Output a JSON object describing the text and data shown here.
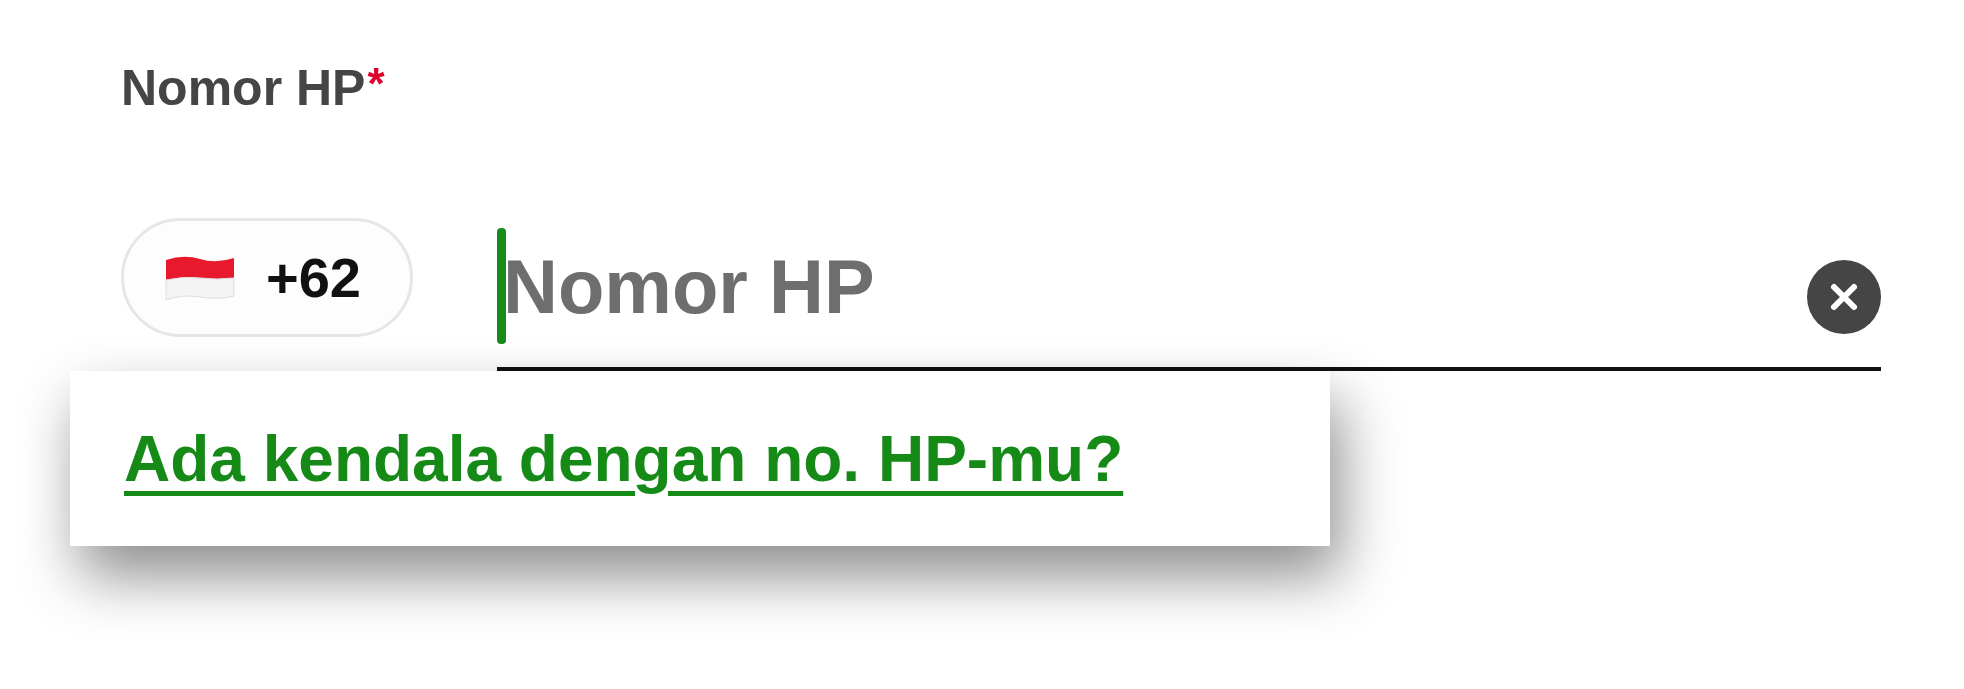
{
  "phone_field": {
    "label": "Nomor HP",
    "required_mark": "*",
    "country_code": "+62",
    "input": {
      "placeholder": "Nomor HP",
      "focused": true
    }
  },
  "popup": {
    "link": "Ada kendala dengan no. HP-mu?"
  }
}
